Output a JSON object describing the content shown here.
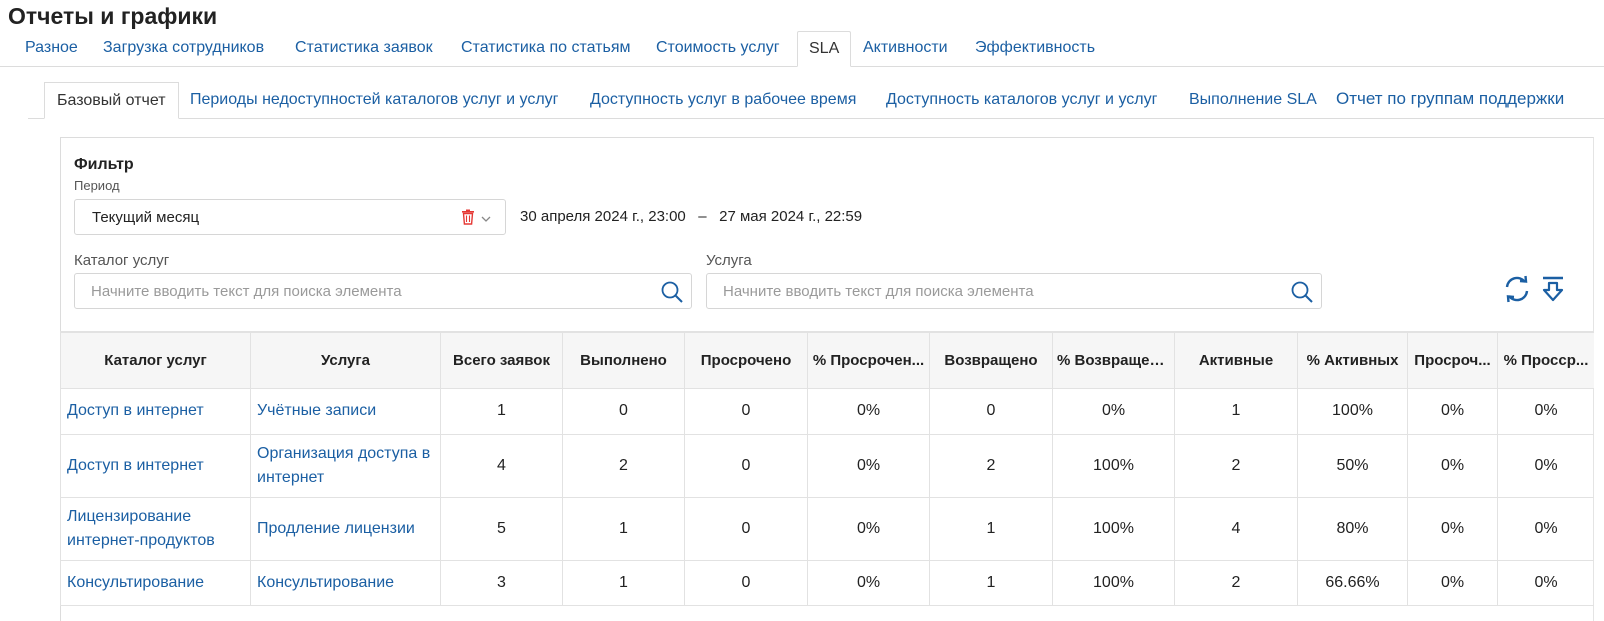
{
  "page": {
    "title": "Отчеты и графики"
  },
  "top_tabs": [
    {
      "label": "Разное"
    },
    {
      "label": "Загрузка сотрудников"
    },
    {
      "label": "Статистика заявок"
    },
    {
      "label": "Статистика по статьям"
    },
    {
      "label": "Стоимость услуг"
    },
    {
      "label": "SLA",
      "active": true
    },
    {
      "label": "Активности"
    },
    {
      "label": "Эффективность"
    }
  ],
  "sub_tabs": [
    {
      "label": "Базовый отчет",
      "active": true
    },
    {
      "label": "Периоды недоступностей каталогов услуг и услуг"
    },
    {
      "label": "Доступность услуг в рабочее время"
    },
    {
      "label": "Доступность каталогов услуг и услуг"
    },
    {
      "label": "Выполнение SLA"
    },
    {
      "label": "Отчет по группам поддержки"
    }
  ],
  "filter": {
    "title": "Фильтр",
    "period_label": "Период",
    "period_value": "Текущий месяц",
    "date_range": "30 апреля 2024 г., 23:00   –   27 мая 2024 г., 22:59",
    "catalog_label": "Каталог услуг",
    "catalog_placeholder": "Начните вводить текст для поиска элемента",
    "service_label": "Услуга",
    "service_placeholder": "Начните вводить текст для поиска элемента"
  },
  "icons": {
    "trash": "trash-icon",
    "chevron": "chevron-down-icon",
    "search": "search-icon",
    "refresh": "refresh-icon",
    "download": "download-icon"
  },
  "colors": {
    "link": "#1b5fa3",
    "icon_blue": "#1b5fa3",
    "trash_red": "#e53935"
  },
  "table": {
    "headers": [
      "Каталог услуг",
      "Услуга",
      "Всего заявок",
      "Выполнено",
      "Просрочено",
      "% Просрочен...",
      "Возвращено",
      "% Возвращен...",
      "Активные",
      "% Активных",
      "Просроч...",
      "% Просср..."
    ],
    "rows": [
      [
        "Доступ в интернет",
        "Учётные записи",
        "1",
        "0",
        "0",
        "0%",
        "0",
        "0%",
        "1",
        "100%",
        "0%",
        "0%"
      ],
      [
        "Доступ в интернет",
        "Организация доступа в интернет",
        "4",
        "2",
        "0",
        "0%",
        "2",
        "100%",
        "2",
        "50%",
        "0%",
        "0%"
      ],
      [
        "Лицензирование интернет-продуктов",
        "Продление лицензии",
        "5",
        "1",
        "0",
        "0%",
        "1",
        "100%",
        "4",
        "80%",
        "0%",
        "0%"
      ],
      [
        "Консультирование",
        "Консультирование",
        "3",
        "1",
        "0",
        "0%",
        "1",
        "100%",
        "2",
        "66.66%",
        "0%",
        "0%"
      ]
    ]
  }
}
